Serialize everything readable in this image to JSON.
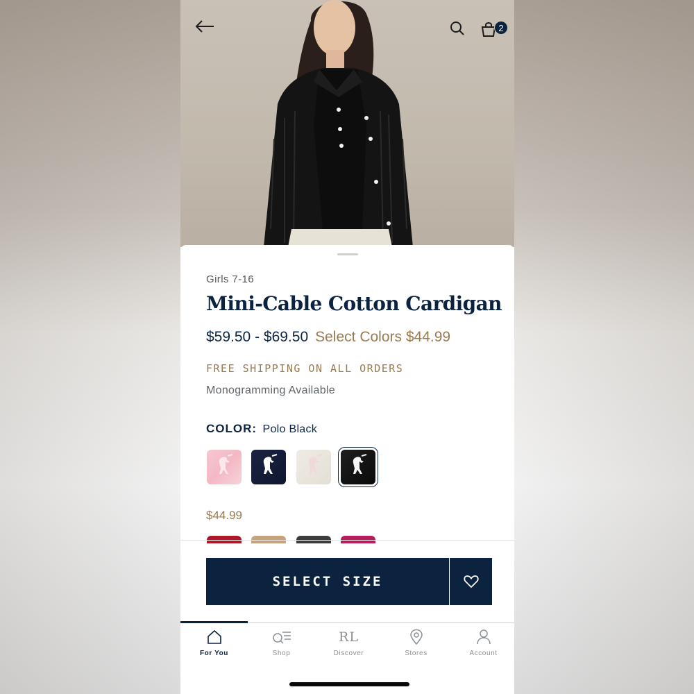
{
  "header": {
    "back_icon": "arrow-left-icon",
    "search_icon": "search-icon",
    "bag_icon": "shopping-bag-icon",
    "bag_count": "2"
  },
  "product": {
    "category": "Girls 7-16",
    "title": "Mini-Cable Cotton Cardigan",
    "price_range": "$59.50 - $69.50",
    "sale_text": "Select Colors $44.99",
    "shipping": "FREE SHIPPING ON ALL ORDERS",
    "monogram": "Monogramming Available"
  },
  "color": {
    "label": "COLOR:",
    "selected": "Polo Black",
    "swatches": [
      {
        "name": "pink",
        "color": "#f4bfca"
      },
      {
        "name": "navy",
        "color": "#141c38"
      },
      {
        "name": "cream",
        "color": "#ebe6de"
      },
      {
        "name": "polo-black",
        "color": "#141414",
        "selected": true
      }
    ],
    "sale_price": "$44.99",
    "sale_swatches": [
      {
        "name": "red",
        "color": "#b0182a"
      },
      {
        "name": "tan",
        "color": "#c7a27b"
      },
      {
        "name": "charcoal",
        "color": "#3c3c3c"
      },
      {
        "name": "magenta",
        "color": "#b81c5c"
      }
    ]
  },
  "actions": {
    "select_size": "SELECT SIZE",
    "wishlist_icon": "heart-icon"
  },
  "tabs": [
    {
      "label": "For You",
      "icon": "home-icon",
      "active": true
    },
    {
      "label": "Shop",
      "icon": "shop-search-icon"
    },
    {
      "label": "Discover",
      "icon": "rl-logo-icon",
      "glyph": "RL"
    },
    {
      "label": "Stores",
      "icon": "location-pin-icon"
    },
    {
      "label": "Account",
      "icon": "person-icon"
    }
  ],
  "theme": {
    "navy": "#0c2340",
    "gold": "#9a7a4f"
  }
}
